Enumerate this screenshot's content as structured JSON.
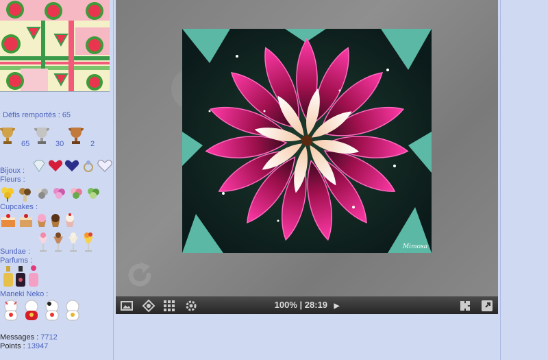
{
  "profile": {
    "challenges_label": "Défis remportés :",
    "challenges_value": "65",
    "trophies": [
      {
        "name": "gold-trophy-icon",
        "count": "65",
        "color": "#c89b3c"
      },
      {
        "name": "silver-trophy-icon",
        "count": "30",
        "color": "#b8b8b8"
      },
      {
        "name": "bronze-trophy-icon",
        "count": "2",
        "color": "#b8733a"
      }
    ],
    "categories": {
      "jewels": "Bijoux :",
      "flowers": "Fleurs :",
      "cupcakes": "Cupcakes :",
      "sundae": "Sundae :",
      "perfumes": "Parfums :",
      "maneki": "Maneki Neko :"
    },
    "messages_label": "Messages :",
    "messages_value": "7712",
    "points_label": "Points :",
    "points_value": "13947"
  },
  "puzzle": {
    "signature": "Mimosa",
    "zoom": "100%",
    "separator": "|",
    "timer": "28:19"
  },
  "toolbar": {
    "icons": [
      "image-preview-icon",
      "ghost-image-icon",
      "grid-icon",
      "settings-gear-icon",
      "edge-pieces-icon",
      "fullscreen-icon"
    ]
  }
}
